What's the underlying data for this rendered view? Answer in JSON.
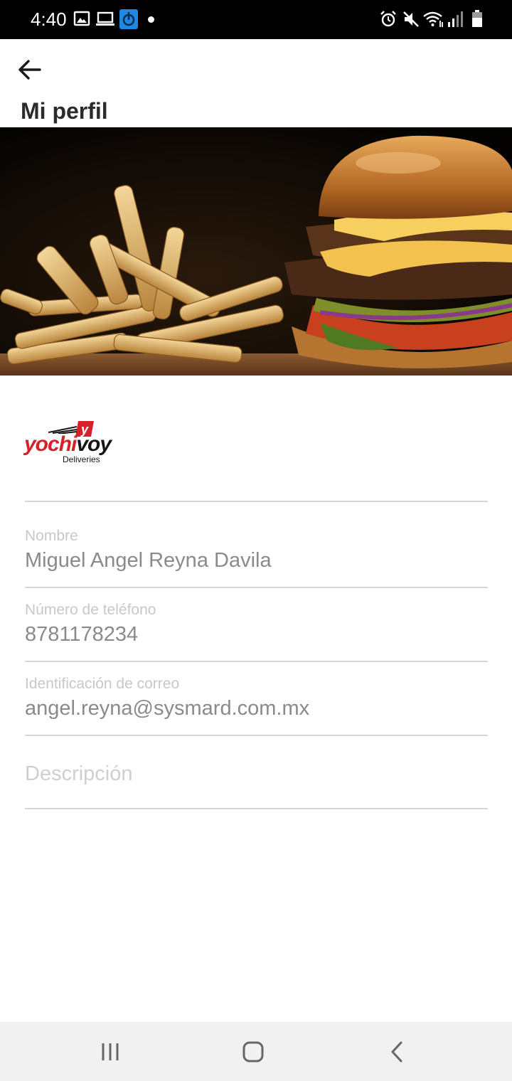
{
  "status_bar": {
    "time": "4:40",
    "left_icons": [
      "image-icon",
      "laptop-icon",
      "app-badge-icon",
      "notification-dot"
    ],
    "right_icons": [
      "alarm-icon",
      "mute-icon",
      "wifi-icon",
      "signal-icon",
      "battery-icon"
    ]
  },
  "app_bar": {
    "back_icon": "arrow-left-icon",
    "title": "Mi perfil"
  },
  "hero": {
    "image": "burger-and-fries-photo"
  },
  "brand": {
    "logo_red": "yochi",
    "logo_black": "voy",
    "badge_letter": "y",
    "subtitle": "Deliveries"
  },
  "profile": {
    "name_label": "Nombre",
    "name_value": "Miguel Angel Reyna Davila",
    "phone_label": "Número de teléfono",
    "phone_value": "8781178234",
    "email_label": "Identificación de correo",
    "email_value": "angel.reyna@sysmard.com.mx",
    "description_placeholder": "Descripción"
  },
  "nav_bar": {
    "icons": [
      "recent-apps-icon",
      "home-icon",
      "back-icon"
    ]
  },
  "colors": {
    "status_bar_bg": "#000000",
    "title_text": "#2b2b2b",
    "label_text": "#c8c8c8",
    "value_text": "#8a8a8a",
    "divider": "#d6d6d6",
    "brand_red": "#d6212a",
    "nav_bar_bg": "#f1f1f1"
  }
}
